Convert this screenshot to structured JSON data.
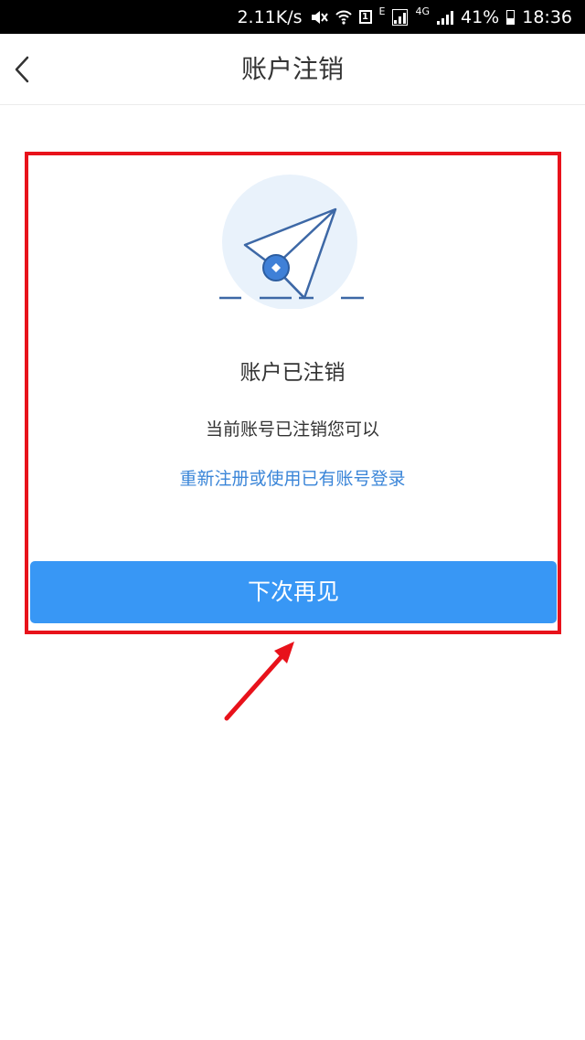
{
  "status_bar": {
    "speed": "2.11K/s",
    "network_e": "E",
    "network_4g": "4G",
    "sim_badge": "1",
    "battery": "41%",
    "time": "18:36",
    "icons": [
      "mute-icon",
      "wifi-icon",
      "sim-icon",
      "signal-icon",
      "battery-icon"
    ]
  },
  "nav": {
    "title": "账户注销",
    "back_icon": "chevron-left-icon"
  },
  "content": {
    "illustration_icon": "paper-plane-icon",
    "title": "账户已注销",
    "description": "当前账号已注销您可以",
    "link": "重新注册或使用已有账号登录",
    "button": "下次再见"
  },
  "colors": {
    "primary": "#3897f5",
    "link": "#3a85d8",
    "annotation": "#e8121b",
    "illustration_bg": "#e9f2fb",
    "illustration_stroke": "#3d68a6"
  }
}
